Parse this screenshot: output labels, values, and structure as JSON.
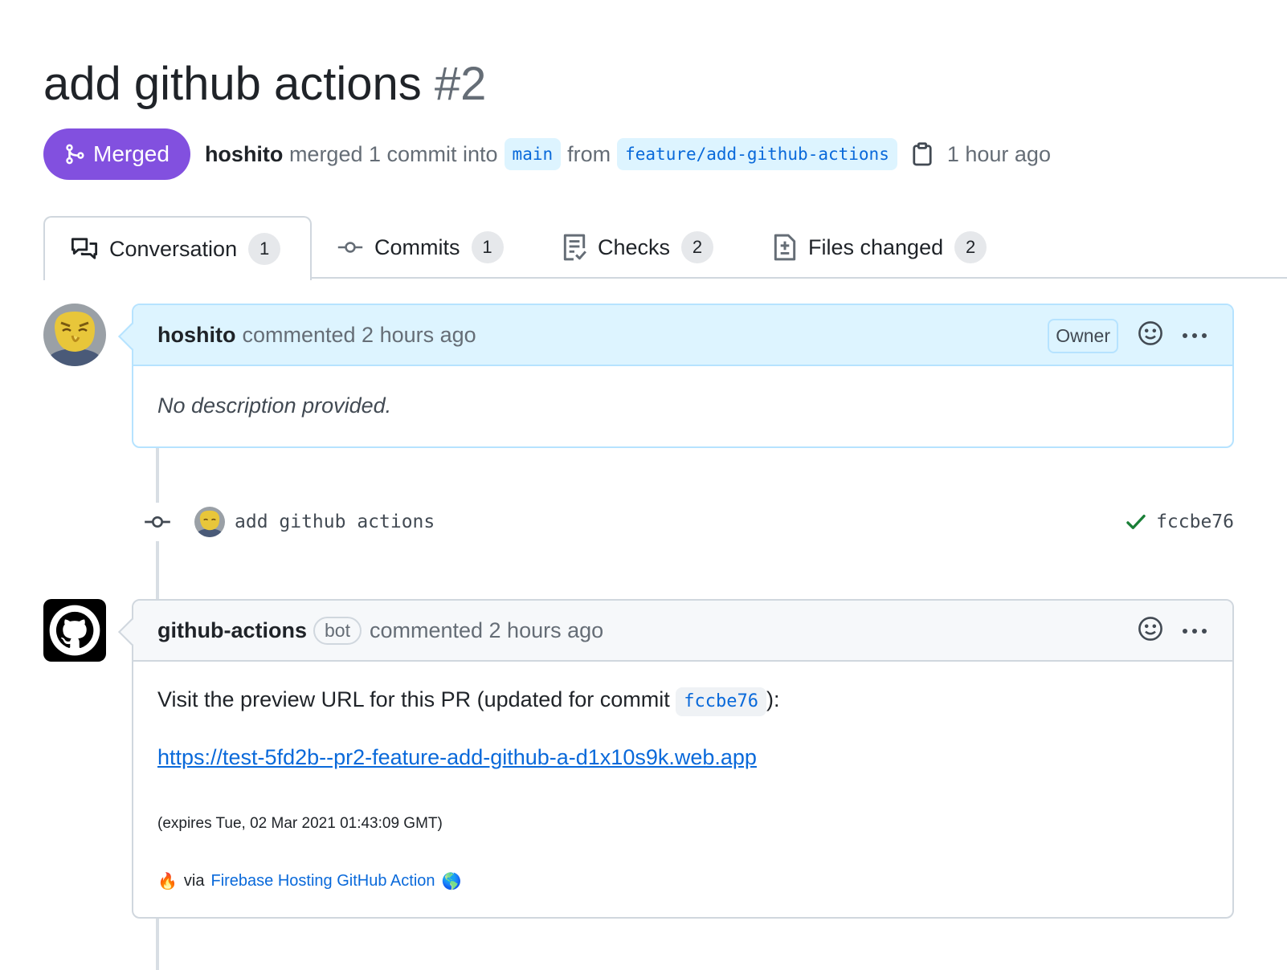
{
  "pr": {
    "title": "add github actions",
    "number": "#2",
    "state": "Merged",
    "author": "hoshito",
    "merge_text": "merged 1 commit into",
    "base_branch": "main",
    "from_text": "from",
    "head_branch": "feature/add-github-actions",
    "time": "1 hour ago"
  },
  "tabs": [
    {
      "label": "Conversation",
      "count": "1",
      "icon": "comment-discussion-icon"
    },
    {
      "label": "Commits",
      "count": "1",
      "icon": "git-commit-icon"
    },
    {
      "label": "Checks",
      "count": "2",
      "icon": "checklist-icon"
    },
    {
      "label": "Files changed",
      "count": "2",
      "icon": "file-diff-icon"
    }
  ],
  "comments": [
    {
      "author": "hoshito",
      "action": "commented 2 hours ago",
      "role_label": "Owner",
      "body": "No description provided."
    },
    {
      "author": "github-actions",
      "bot_label": "bot",
      "action": "commented 2 hours ago",
      "body_prefix": "Visit the preview URL for this PR (updated for commit",
      "body_commit": "fccbe76",
      "body_suffix": "):",
      "preview_url": "https://test-5fd2b--pr2-feature-add-github-a-d1x10s9k.web.app",
      "expires": "(expires Tue, 02 Mar 2021 01:43:09 GMT)",
      "fire_emoji": "🔥",
      "via_text": "via",
      "action_link": "Firebase Hosting GitHub Action",
      "globe_emoji": "🌎"
    }
  ],
  "commit": {
    "message": "add github actions",
    "sha": "fccbe76",
    "status": "success"
  },
  "colors": {
    "merged": "#8250df",
    "link": "#0969da",
    "success": "#1a7f37",
    "owner_header": "#ddf4ff"
  }
}
